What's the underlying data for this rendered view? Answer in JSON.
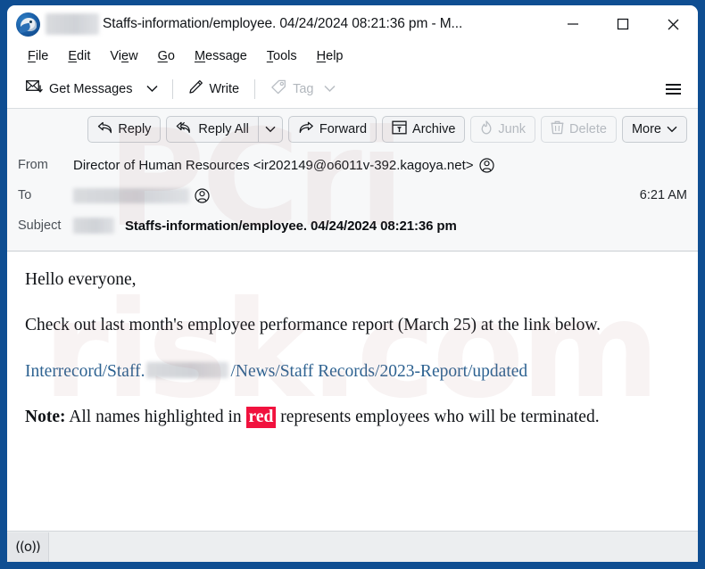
{
  "window": {
    "title": "Staffs-information/employee. 04/24/2024 08:21:36 pm - M...",
    "app_icon": "thunderbird-logo",
    "minimize_label": "Minimize",
    "maximize_label": "Maximize",
    "close_label": "Close",
    "title_redaction": "redacted"
  },
  "menubar": {
    "items": [
      {
        "label": "File",
        "accesskey": "F"
      },
      {
        "label": "Edit",
        "accesskey": "E"
      },
      {
        "label": "View",
        "accesskey": "V"
      },
      {
        "label": "Go",
        "accesskey": "G"
      },
      {
        "label": "Message",
        "accesskey": "M"
      },
      {
        "label": "Tools",
        "accesskey": "T"
      },
      {
        "label": "Help",
        "accesskey": "H"
      }
    ]
  },
  "toolbar": {
    "get_messages_label": "Get Messages",
    "get_messages_icon": "envelope-download-icon",
    "get_messages_chevron_icon": "chevron-down-icon",
    "write_label": "Write",
    "write_icon": "pencil-icon",
    "tag_label": "Tag",
    "tag_icon": "tag-icon",
    "tag_chevron_icon": "chevron-down-icon",
    "tag_disabled": true,
    "app_menu_icon": "hamburger-icon"
  },
  "message_actions": {
    "buttons": [
      {
        "label": "Reply",
        "icon": "reply-arrow-icon",
        "disabled": false
      },
      {
        "label": "Reply All",
        "icon": "reply-all-arrow-icon",
        "disabled": false
      },
      {
        "label": "Forward",
        "icon": "forward-arrow-icon",
        "disabled": false
      },
      {
        "label": "Archive",
        "icon": "archive-box-icon",
        "disabled": false
      },
      {
        "label": "Junk",
        "icon": "flame-icon",
        "disabled": true
      },
      {
        "label": "Delete",
        "icon": "trash-icon",
        "disabled": true
      },
      {
        "label": "More",
        "icon": "chevron-down-icon",
        "disabled": false
      }
    ],
    "reply_all_chevron_icon": "chevron-down-icon"
  },
  "headers": {
    "from_label": "From",
    "from_value": "Director of Human Resources <ir202149@o6011v-392.kagoya.net>",
    "from_contact_icon": "contact-person-icon",
    "to_label": "To",
    "to_value_redacted": "redacted",
    "to_contact_icon": "contact-person-icon",
    "time": "6:21 AM",
    "subject_label": "Subject",
    "subject_redacted": "redacted",
    "subject_value": "Staffs-information/employee. 04/24/2024 08:21:36 pm"
  },
  "body": {
    "greeting": "Hello everyone,",
    "paragraph": "Check out last month's employee performance report (March 25) at the link below.",
    "link_prefix": "Interrecord/Staff.",
    "link_redacted": "redacted",
    "link_suffix": "/News/Staff Records/2023-Report/updated",
    "note_label": "Note:",
    "note_before": " All names highlighted in ",
    "note_highlight": "red",
    "note_after": " represents employees who will be terminated."
  },
  "statusbar": {
    "indicator_icon": "online-signal-icon",
    "indicator_glyph": "((o))"
  },
  "watermark": {
    "line1": "PCri",
    "line2": "risk.com"
  },
  "colors": {
    "window_frame": "#0f4e92",
    "link": "#2d6291",
    "highlight_red": "#f1123e",
    "header_bg": "#f7f8f9",
    "statusbar_bg": "#eceef0"
  }
}
